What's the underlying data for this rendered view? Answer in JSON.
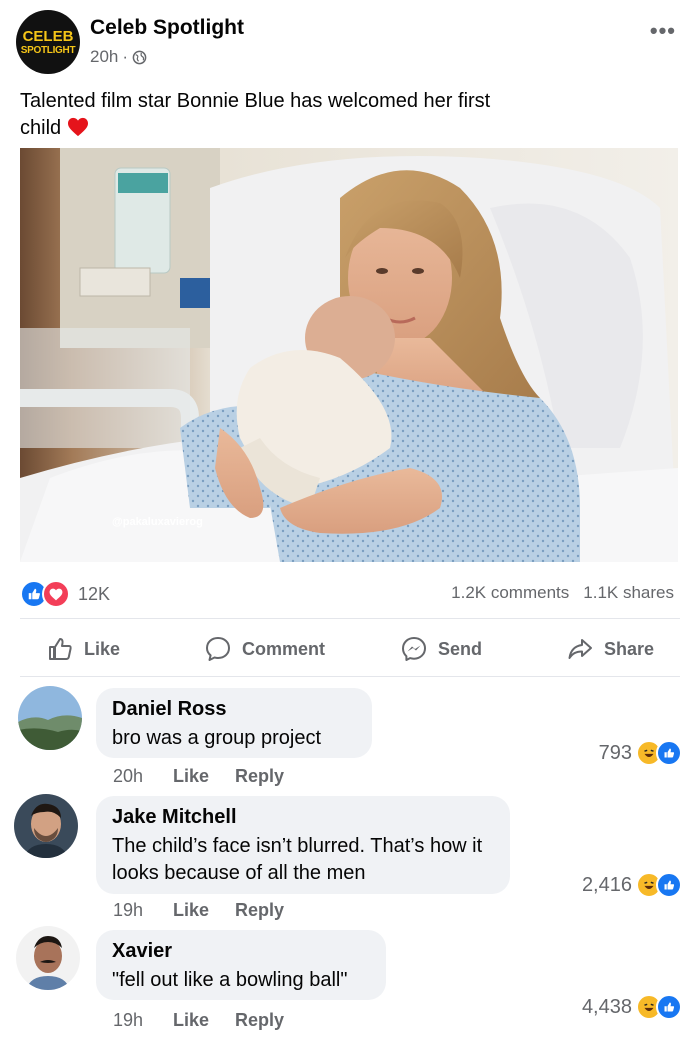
{
  "post": {
    "page_logo": {
      "line1": "CELEB",
      "line2": "SPOTLIGHT"
    },
    "page_name": "Celeb Spotlight",
    "time": "20h",
    "separator": "·",
    "more_label": "•••",
    "caption": "Talented film star Bonnie Blue has welcomed her first child",
    "photo_watermark": "@pakaluxavierog"
  },
  "reactions": {
    "count": "12K",
    "comments": "1.2K comments",
    "shares": "1.1K shares",
    "icons": [
      "like-icon",
      "love-icon"
    ]
  },
  "actions": {
    "like": "Like",
    "comment": "Comment",
    "send": "Send",
    "share": "Share"
  },
  "comments": [
    {
      "name": "Daniel Ross",
      "text": "bro was a group project",
      "time": "20h",
      "like": "Like",
      "reply": "Reply",
      "reactions": "793"
    },
    {
      "name": "Jake Mitchell",
      "text": "The child’s face isn’t blurred. That’s how it looks because of all the men",
      "time": "19h",
      "like": "Like",
      "reply": "Reply",
      "reactions": "2,416"
    },
    {
      "name": "Xavier",
      "text": "\"fell out like a bowling ball\"",
      "time": "19h",
      "like": "Like",
      "reply": "Reply",
      "reactions": "4,438"
    }
  ],
  "colors": {
    "accent": "#1877f2",
    "love": "#f33e58",
    "haha": "#f7b928",
    "muted_text": "#65676b",
    "bubble": "#f0f2f5"
  }
}
